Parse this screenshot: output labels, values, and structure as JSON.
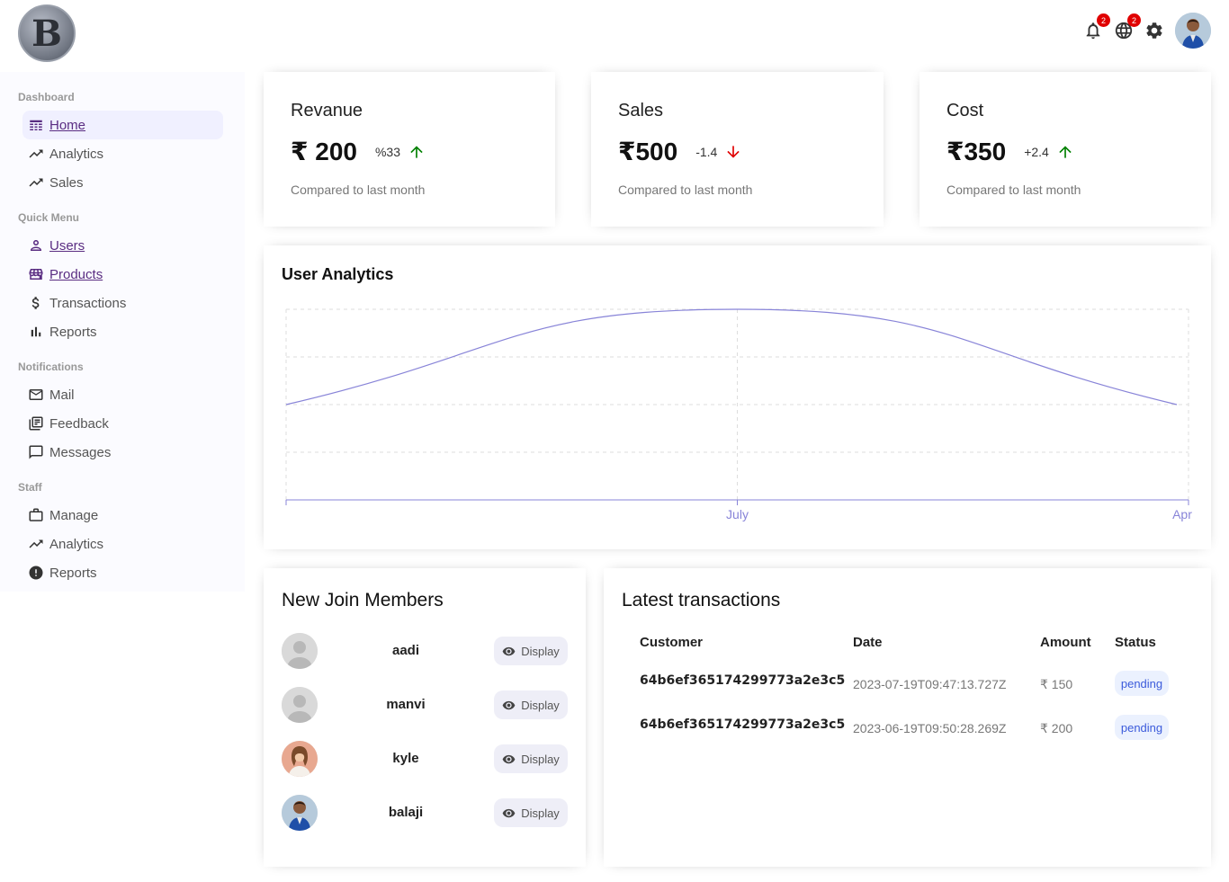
{
  "header": {
    "logo_letter": "B",
    "notifications_badge": "2",
    "language_badge": "2"
  },
  "sidebar": {
    "sections": [
      {
        "title": "Dashboard",
        "items": [
          {
            "label": "Home",
            "icon": "home-icon",
            "active": true,
            "link": true
          },
          {
            "label": "Analytics",
            "icon": "trending-up-icon"
          },
          {
            "label": "Sales",
            "icon": "trending-up-icon"
          }
        ]
      },
      {
        "title": "Quick Menu",
        "items": [
          {
            "label": "Users",
            "icon": "user-icon",
            "link": true
          },
          {
            "label": "Products",
            "icon": "store-icon",
            "link": true
          },
          {
            "label": "Transactions",
            "icon": "dollar-icon"
          },
          {
            "label": "Reports",
            "icon": "bar-chart-icon"
          }
        ]
      },
      {
        "title": "Notifications",
        "items": [
          {
            "label": "Mail",
            "icon": "mail-icon"
          },
          {
            "label": "Feedback",
            "icon": "feedback-icon"
          },
          {
            "label": "Messages",
            "icon": "message-icon"
          }
        ]
      },
      {
        "title": "Staff",
        "items": [
          {
            "label": "Manage",
            "icon": "briefcase-icon"
          },
          {
            "label": "Analytics",
            "icon": "trending-up-icon"
          },
          {
            "label": "Reports",
            "icon": "report-icon"
          }
        ]
      }
    ]
  },
  "featured": [
    {
      "title": "Revanue",
      "money": "₹ 200",
      "rate": "%33",
      "trend": "up",
      "sub": "Compared to last month"
    },
    {
      "title": "Sales",
      "money": "₹500",
      "rate": "-1.4",
      "trend": "down",
      "sub": "Compared to last month"
    },
    {
      "title": "Cost",
      "money": "₹350",
      "rate": "+2.4",
      "trend": "up",
      "sub": "Compared to last month"
    }
  ],
  "colors": {
    "up": "#008000",
    "down": "#e00000",
    "line": "#8884d8",
    "link": "#5a2d82"
  },
  "chart_data": {
    "type": "line",
    "title": "User Analytics",
    "x": [
      "",
      "July",
      "Apr"
    ],
    "series": [
      {
        "values": [
          2,
          4,
          2
        ]
      }
    ],
    "ylim": [
      0,
      4
    ],
    "grid": true,
    "dashed_grid": true
  },
  "members": {
    "title": "New Join Members",
    "button_label": "Display",
    "items": [
      {
        "name": "aadi",
        "avatar": "default"
      },
      {
        "name": "manvi",
        "avatar": "default"
      },
      {
        "name": "kyle",
        "avatar": "photo-woman"
      },
      {
        "name": "balaji",
        "avatar": "photo-man"
      }
    ]
  },
  "transactions": {
    "title": "Latest transactions",
    "headers": [
      "Customer",
      "Date",
      "Amount",
      "Status"
    ],
    "rows": [
      {
        "customer": "64b6ef365174299773a2e3c5",
        "date": "2023-07-19T09:47:13.727Z",
        "amount": "₹ 150",
        "status": "pending"
      },
      {
        "customer": "64b6ef365174299773a2e3c5",
        "date": "2023-06-19T09:50:28.269Z",
        "amount": "₹ 200",
        "status": "pending"
      }
    ]
  }
}
